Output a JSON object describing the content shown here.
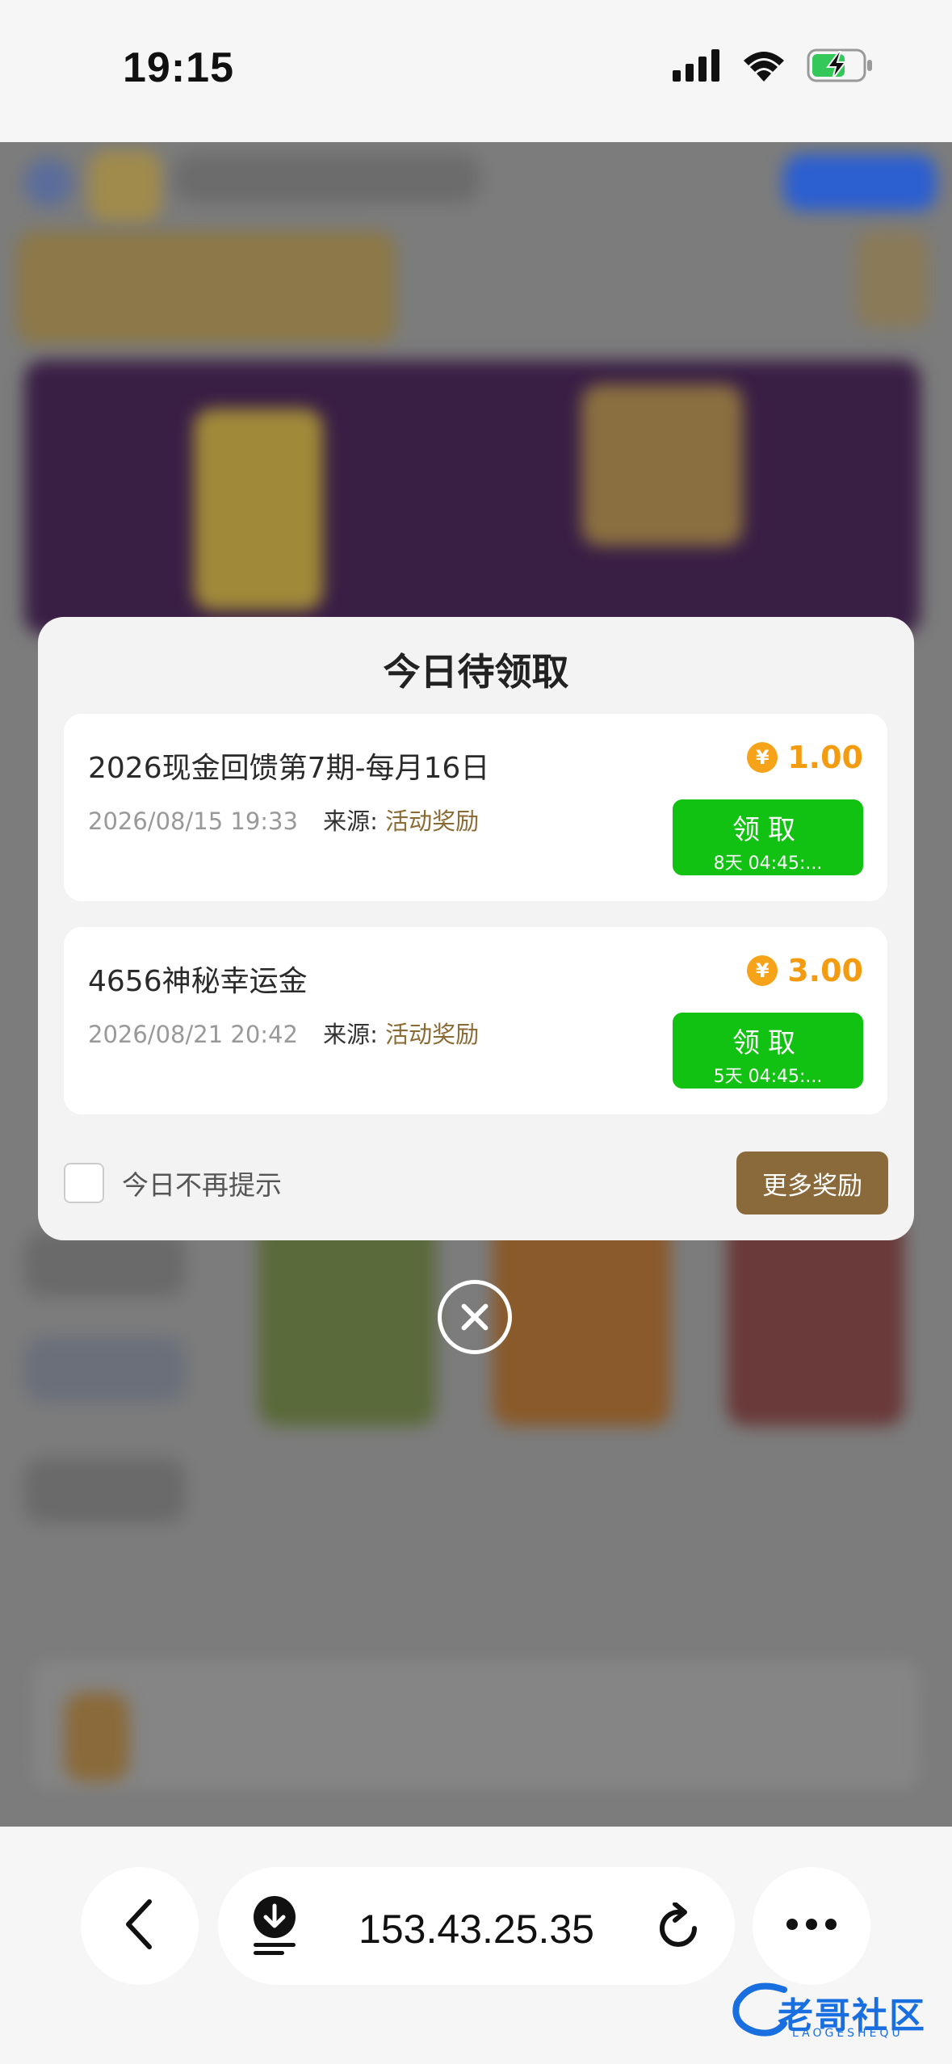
{
  "status": {
    "time": "19:15"
  },
  "modal": {
    "title": "今日待领取",
    "rewards": [
      {
        "title": "2026现金回馈第7期-每月16日",
        "amount": "1.00",
        "date": "2026/08/15 19:33",
        "source_label": "来源:",
        "source_value": "活动奖励",
        "claim_label": "领取",
        "countdown": "8天 04:45:..."
      },
      {
        "title": "4656神秘幸运金",
        "amount": "3.00",
        "date": "2026/08/21 20:42",
        "source_label": "来源:",
        "source_value": "活动奖励",
        "claim_label": "领取",
        "countdown": "5天 04:45:..."
      }
    ],
    "no_remind_label": "今日不再提示",
    "more_rewards_label": "更多奖励",
    "currency_symbol": "¥"
  },
  "browser": {
    "url": "153.43.25.35"
  },
  "watermark": {
    "text": "老哥社区",
    "sub": "LAOGESHEQU"
  },
  "colors": {
    "claim_green": "#12c212",
    "amount_orange": "#f39c12",
    "brand_brown": "#8a6a3a"
  },
  "icons": [
    "signal-icon",
    "wifi-icon",
    "battery-charging-icon",
    "yen-icon",
    "close-icon",
    "back-icon",
    "download-icon",
    "reload-icon",
    "more-icon"
  ]
}
